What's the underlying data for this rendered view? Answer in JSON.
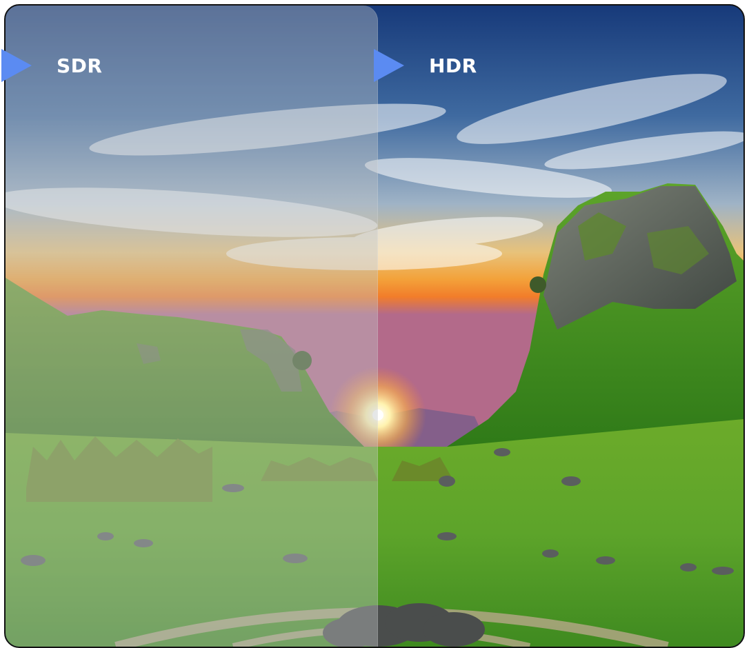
{
  "labels": {
    "left": "SDR",
    "right": "HDR"
  },
  "colors": {
    "marker": "#5b8bf2",
    "label_text": "#ffffff",
    "frame_border": "#111111"
  },
  "icons": {
    "marker": "play-triangle-icon"
  }
}
